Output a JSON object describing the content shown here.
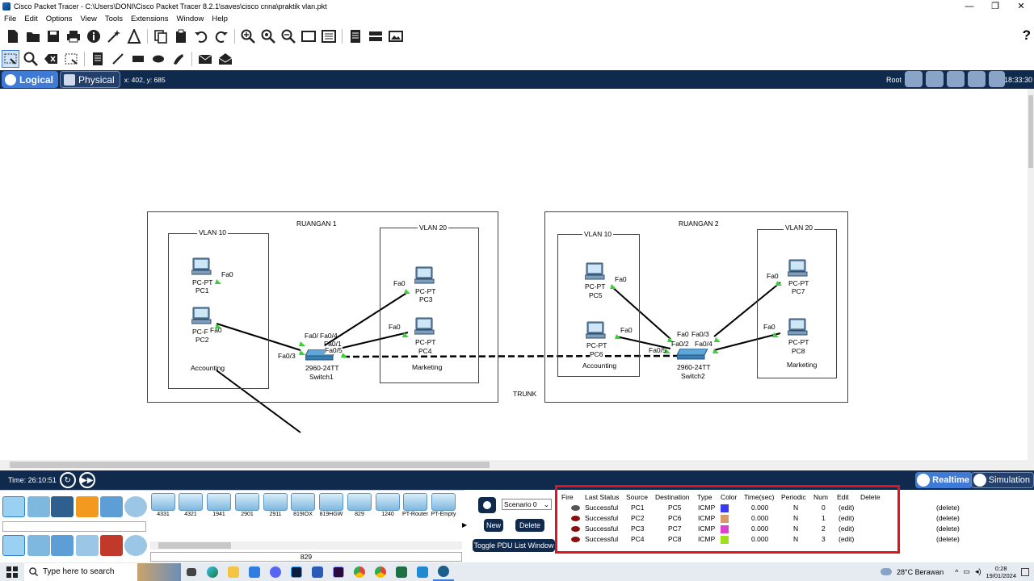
{
  "window": {
    "title": "Cisco Packet Tracer - C:\\Users\\DONI\\Cisco Packet Tracer 8.2.1\\saves\\cisco cnna\\praktik vlan.pkt",
    "controls": [
      "—",
      "❐",
      "✕"
    ]
  },
  "menu": [
    "File",
    "Edit",
    "Options",
    "View",
    "Tools",
    "Extensions",
    "Window",
    "Help"
  ],
  "toolbar": {
    "main_icons": [
      "new-icon",
      "open-icon",
      "save-icon",
      "print-icon",
      "info-icon",
      "wizard-icon",
      "activity-icon",
      "copy-icon",
      "paste-icon",
      "undo-icon",
      "redo-icon",
      "zoom-in-icon",
      "zoom-reset-icon",
      "zoom-out-icon",
      "rectangle-view-icon",
      "palette-icon",
      "notes-icon",
      "device-template-icon",
      "screenshot-icon"
    ],
    "help_label": "?",
    "tools_icons": [
      "select-icon",
      "inspect-icon",
      "delete-icon",
      "resize-icon",
      "note-icon",
      "line-icon",
      "rect-icon",
      "ellipse-icon",
      "freeform-icon",
      "simple-pdu-icon",
      "complex-pdu-icon"
    ]
  },
  "workspace": {
    "logical_label": "Logical",
    "physical_label": "Physical",
    "coords": "x: 402, y: 685",
    "root_label": "Root",
    "clock": "18:33:30"
  },
  "topology": {
    "room1": "RUANGAN 1",
    "room2": "RUANGAN 2",
    "trunk": "TRUNK",
    "vlan10": "VLAN 10",
    "vlan20": "VLAN 20",
    "accounting": "Accounting",
    "marketing": "Marketing",
    "pc_type": "PC-PT",
    "switch_model": "2960-24TT",
    "switch1": "Switch1",
    "switch2": "Switch2",
    "pcs": [
      "PC1",
      "PC2",
      "PC3",
      "PC4",
      "PC5",
      "PC6",
      "PC7",
      "PC8"
    ],
    "ports": {
      "fa0": "Fa0",
      "s1_pc1": "Fa0/",
      "s1_pc2": "Fa0/3",
      "s1_pc3": "Fa0/4",
      "s1_pc4": "Fa0/1",
      "s1_trunk": "Fa0/5",
      "s2_pc5": "Fa0",
      "s2_pc6": "Fa0/2",
      "s2_pc7": "Fa0/3",
      "s2_pc8": "Fa0/4",
      "s2_trunk": "Fa0/5",
      "pc2_trunc": "PC-F",
      "pc6_trunc": "PC-PT"
    }
  },
  "timebar": {
    "time": "Time: 26:10:51",
    "realtime_label": "Realtime",
    "simulation_label": "Simulation"
  },
  "devices": {
    "categories": [
      "network-devices-icon",
      "end-devices-icon",
      "components-icon",
      "connections-icon",
      "misc-icon",
      "multiuser-icon"
    ],
    "subcategories": [
      "routers-icon",
      "switches-icon",
      "hubs-icon",
      "wireless-icon",
      "security-icon",
      "wan-emulation-icon"
    ],
    "models": [
      "4331",
      "4321",
      "1941",
      "2901",
      "2911",
      "819IOX",
      "819HGW",
      "829",
      "1240",
      "PT-Router",
      "PT-Empty"
    ],
    "selected_model": "829"
  },
  "pdu": {
    "scenario": "Scenario 0",
    "new_label": "New",
    "delete_label": "Delete",
    "toggle_label": "Toggle PDU List Window",
    "headers": [
      "Fire",
      "Last Status",
      "Source",
      "Destination",
      "Type",
      "Color",
      "Time(sec)",
      "Periodic",
      "Num",
      "Edit",
      "Delete"
    ],
    "rows": [
      {
        "status": "Successful",
        "source": "PC1",
        "dest": "PC5",
        "type": "ICMP",
        "color": "#3a3af0",
        "time": "0.000",
        "periodic": "N",
        "num": "0",
        "edit": "(edit)",
        "delete": "(delete)"
      },
      {
        "status": "Successful",
        "source": "PC2",
        "dest": "PC6",
        "type": "ICMP",
        "color": "#d89a6a",
        "time": "0.000",
        "periodic": "N",
        "num": "1",
        "edit": "(edit)",
        "delete": "(delete)"
      },
      {
        "status": "Successful",
        "source": "PC3",
        "dest": "PC7",
        "type": "ICMP",
        "color": "#e040d0",
        "time": "0.000",
        "periodic": "N",
        "num": "2",
        "edit": "(edit)",
        "delete": "(delete)"
      },
      {
        "status": "Successful",
        "source": "PC4",
        "dest": "PC8",
        "type": "ICMP",
        "color": "#9ee01a",
        "time": "0.000",
        "periodic": "N",
        "num": "3",
        "edit": "(edit)",
        "delete": "(delete)"
      }
    ]
  },
  "taskbar": {
    "search_placeholder": "Type here to search",
    "weather": "28°C  Berawan",
    "time": "0:28",
    "date": "19/01/2024",
    "apps": [
      "task-view-icon",
      "edge-icon",
      "file-explorer-icon",
      "store-icon",
      "discord-icon",
      "photoshop-icon",
      "word-icon",
      "premiere-icon",
      "chrome-icon",
      "chrome-profile-icon",
      "excel-icon",
      "vscode-icon",
      "packet-tracer-icon"
    ]
  }
}
